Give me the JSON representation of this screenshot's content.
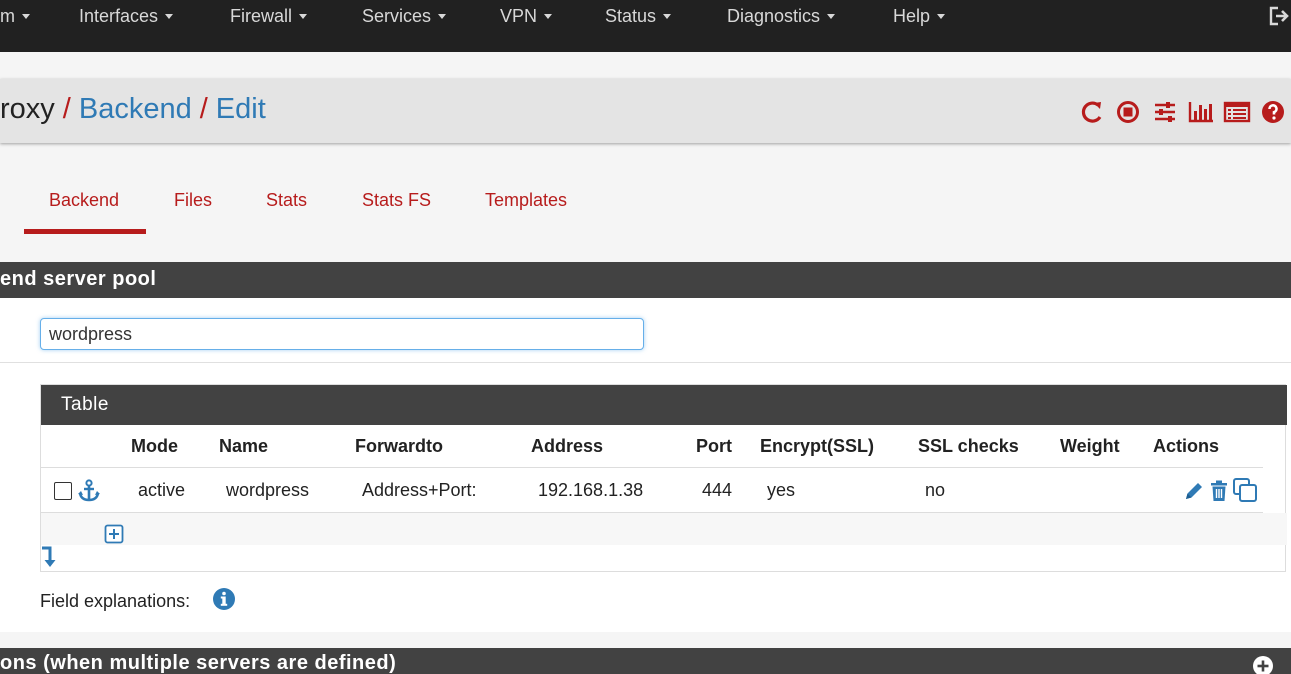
{
  "nav": {
    "items": [
      {
        "label": "m"
      },
      {
        "label": "Interfaces"
      },
      {
        "label": "Firewall"
      },
      {
        "label": "Services"
      },
      {
        "label": "VPN"
      },
      {
        "label": "Status"
      },
      {
        "label": "Diagnostics"
      },
      {
        "label": "Help"
      }
    ],
    "logout_icon": "sign-out-icon"
  },
  "breadcrumb": {
    "part1": "roxy",
    "sep": "/",
    "part2": "Backend",
    "part3": "Edit",
    "icons": [
      "restart-icon",
      "stop-icon",
      "settings-sliders-icon",
      "stats-bar-chart-icon",
      "log-list-icon",
      "help-icon"
    ]
  },
  "tabs": [
    {
      "label": "Backend",
      "active": true
    },
    {
      "label": "Files"
    },
    {
      "label": "Stats"
    },
    {
      "label": "Stats FS"
    },
    {
      "label": "Templates"
    }
  ],
  "section": {
    "title": "end server pool"
  },
  "name_field": {
    "value": "wordpress"
  },
  "table": {
    "title": "Table",
    "headers": [
      "Mode",
      "Name",
      "Forwardto",
      "Address",
      "Port",
      "Encrypt(SSL)",
      "SSL checks",
      "Weight",
      "Actions"
    ],
    "rows": [
      {
        "mode": "active",
        "name": "wordpress",
        "forwardto": "Address+Port:",
        "address": "192.168.1.38",
        "port": "444",
        "encrypt": "yes",
        "ssl_checks": "no",
        "weight": ""
      }
    ]
  },
  "field_explanations": {
    "label": "Field explanations:"
  },
  "section2": {
    "title": "ons (when multiple servers are defined)"
  },
  "colors": {
    "navbar": "#212121",
    "accent_red": "#b71c1c",
    "link_blue": "#2f7ab5",
    "section_dark": "#424242"
  }
}
